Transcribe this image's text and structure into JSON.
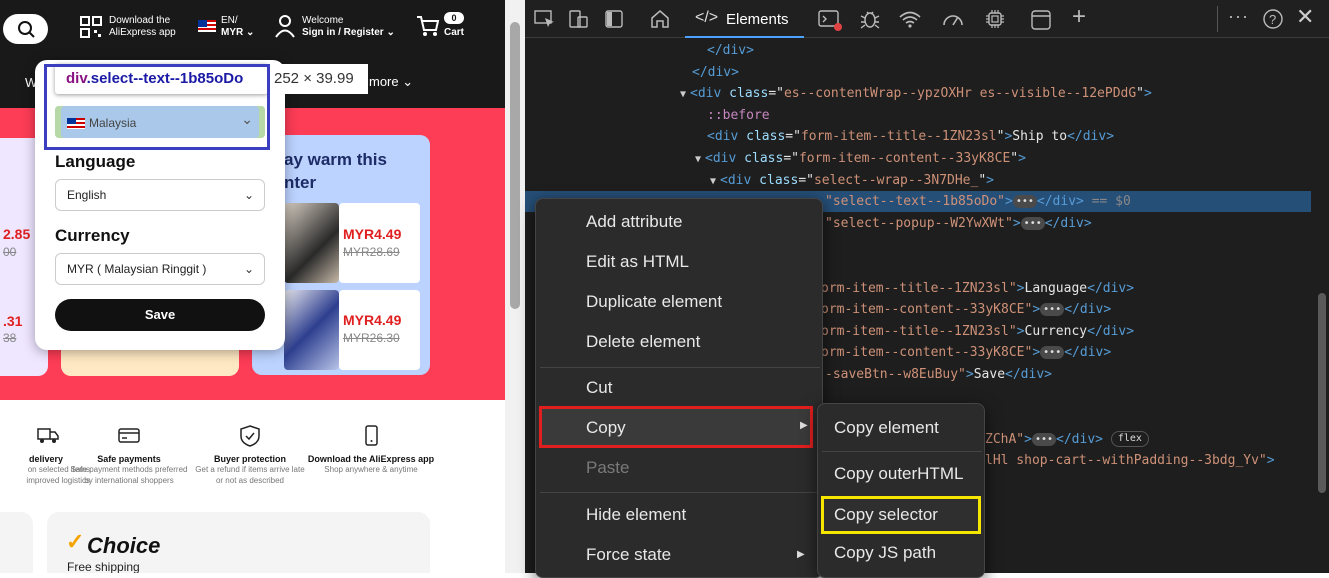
{
  "site": {
    "download": {
      "line1": "Download the",
      "line2": "AliExpress app"
    },
    "region": {
      "lang": "EN/",
      "currency": "MYR"
    },
    "account": {
      "welcome": "Welcome",
      "signin": "Sign in / Register"
    },
    "cart": {
      "label": "Cart",
      "count": "0"
    },
    "nav": {
      "w": "W",
      "more": "more"
    },
    "hero": {
      "title": "ay warm this\nnter",
      "price1": "MYR4.49",
      "old1": "MYR28.69",
      "price2": "MYR4.49",
      "old2": "MYR26.30",
      "left_price1": "2.85",
      "left_old1": "00",
      "left_price2": ".31",
      "left_old2": "38"
    },
    "popover": {
      "ship_selected": "Malaysia",
      "language_label": "Language",
      "language_value": "English",
      "currency_label": "Currency",
      "currency_value": "MYR ( Malaysian Ringgit )",
      "save": "Save"
    },
    "inspect_tip": {
      "tag": "div",
      "cls": ".select--text--1b85oDo",
      "size": "252 × 39.99"
    },
    "features": [
      {
        "title": "delivery",
        "desc": "on selected items\nimproved logistics"
      },
      {
        "title": "Safe payments",
        "desc": "Safe payment methods preferred\nby international shoppers"
      },
      {
        "title": "Buyer protection",
        "desc": "Get a refund if items arrive late\nor not as described"
      },
      {
        "title": "Download the AliExpress app",
        "desc": "Shop anywhere & anytime"
      }
    ],
    "choice": {
      "title": "Choice",
      "sub": "Free shipping"
    }
  },
  "devtools": {
    "tab": "Elements",
    "code": [
      {
        "i": 182,
        "parts": [
          [
            "tg",
            "</div>"
          ]
        ]
      },
      {
        "i": 167,
        "parts": [
          [
            "tg",
            "</div>"
          ]
        ]
      },
      {
        "i": 155,
        "tri": "▼",
        "parts": [
          [
            "tg",
            "<div "
          ],
          [
            "at",
            "class"
          ],
          [
            "tx",
            "=\""
          ],
          [
            "av",
            "es--contentWrap--ypzOXHr es--visible--12ePDdG"
          ],
          [
            "tx",
            "\""
          ],
          [
            "tg",
            ">"
          ]
        ]
      },
      {
        "i": 182,
        "parts": [
          [
            "ps",
            "::before"
          ]
        ]
      },
      {
        "i": 182,
        "parts": [
          [
            "tg",
            "<div "
          ],
          [
            "at",
            "class"
          ],
          [
            "tx",
            "=\""
          ],
          [
            "av",
            "form-item--title--1ZN23sl"
          ],
          [
            "tx",
            "\""
          ],
          [
            "tg",
            ">"
          ],
          [
            "tx",
            "Ship to"
          ],
          [
            "tg",
            "</div>"
          ]
        ]
      },
      {
        "i": 170,
        "tri": "▼",
        "parts": [
          [
            "tg",
            "<div "
          ],
          [
            "at",
            "class"
          ],
          [
            "tx",
            "=\""
          ],
          [
            "av",
            "form-item--content--33yK8CE"
          ],
          [
            "tx",
            "\""
          ],
          [
            "tg",
            ">"
          ]
        ]
      },
      {
        "i": 185,
        "tri": "▼",
        "parts": [
          [
            "tg",
            "<div "
          ],
          [
            "at",
            "class"
          ],
          [
            "tx",
            "=\""
          ],
          [
            "av",
            "select--wrap--3N7DHe_"
          ],
          [
            "tx",
            "\""
          ],
          [
            "tg",
            ">"
          ]
        ]
      },
      {
        "i": 300,
        "sel": true,
        "parts": [
          [
            "av",
            "\"select--text--1b85oDo\""
          ],
          [
            "tg",
            ">"
          ],
          [
            "dots",
            "•••"
          ],
          [
            "tg",
            "</div>"
          ],
          [
            "gray",
            " == $0"
          ]
        ]
      },
      {
        "i": 300,
        "parts": [
          [
            "av",
            "\"select--popup--W2YwXWt\""
          ],
          [
            "tg",
            ">"
          ],
          [
            "dots",
            "•••"
          ],
          [
            "tg",
            "</div>"
          ]
        ]
      },
      {
        "i": 0,
        "parts": []
      },
      {
        "i": 0,
        "parts": []
      },
      {
        "i": 296,
        "parts": [
          [
            "av",
            "orm-item--title--1ZN23sl\""
          ],
          [
            "tg",
            ">"
          ],
          [
            "tx",
            "Language"
          ],
          [
            "tg",
            "</div>"
          ]
        ]
      },
      {
        "i": 296,
        "parts": [
          [
            "av",
            "orm-item--content--33yK8CE\""
          ],
          [
            "tg",
            ">"
          ],
          [
            "dots",
            "•••"
          ],
          [
            "tg",
            "</div>"
          ]
        ]
      },
      {
        "i": 296,
        "parts": [
          [
            "av",
            "orm-item--title--1ZN23sl\""
          ],
          [
            "tg",
            ">"
          ],
          [
            "tx",
            "Currency"
          ],
          [
            "tg",
            "</div>"
          ]
        ]
      },
      {
        "i": 296,
        "parts": [
          [
            "av",
            "orm-item--content--33yK8CE\""
          ],
          [
            "tg",
            ">"
          ],
          [
            "dots",
            "•••"
          ],
          [
            "tg",
            "</div>"
          ]
        ]
      },
      {
        "i": 300,
        "parts": [
          [
            "av",
            "-saveBtn--w8EuBuy\""
          ],
          [
            "tg",
            ">"
          ],
          [
            "tx",
            "Save"
          ],
          [
            "tg",
            "</div>"
          ]
        ]
      },
      {
        "i": 0,
        "parts": []
      },
      {
        "i": 0,
        "parts": []
      },
      {
        "i": 460,
        "parts": [
          [
            "av",
            "ZChA\""
          ],
          [
            "tg",
            ">"
          ],
          [
            "dots",
            "•••"
          ],
          [
            "tg",
            "</div> "
          ],
          [
            "flex",
            "flex"
          ]
        ]
      },
      {
        "i": 460,
        "parts": [
          [
            "av",
            "lHl shop-cart--withPadding--3bdg_Yv\""
          ],
          [
            "tg",
            ">"
          ]
        ]
      }
    ]
  },
  "context_menu": {
    "items": [
      "Add attribute",
      "Edit as HTML",
      "Duplicate element",
      "Delete element",
      "Cut",
      "Copy",
      "Paste",
      "Hide element",
      "Force state"
    ],
    "submenu": [
      "Copy element",
      "Copy outerHTML",
      "Copy selector",
      "Copy JS path"
    ]
  },
  "colors": {
    "highlight_red": "#e21f1f",
    "highlight_yellow": "#f5e600",
    "inspect_blue": "#3b3fbf",
    "hero_pink": "#fd3c56"
  }
}
